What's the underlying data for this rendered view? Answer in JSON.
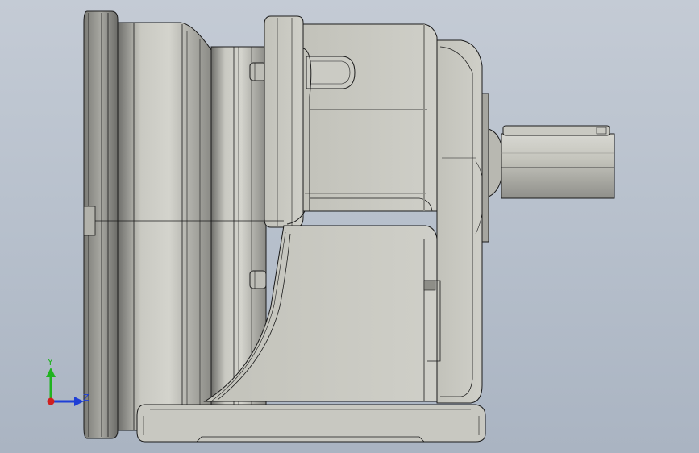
{
  "viewport": {
    "background_top": "#c4cbd5",
    "background_bottom": "#aab4c2"
  },
  "model": {
    "name": "gear-motor-reducer",
    "body_color": "#c6c6be",
    "shadow_color": "#8e8e88",
    "edge_color": "#1a1a1a"
  },
  "triad": {
    "y_label": "Y",
    "z_label": "Z",
    "y_color": "#1fb31f",
    "z_color": "#1f3fd6",
    "x_color": "#d01f1f"
  }
}
